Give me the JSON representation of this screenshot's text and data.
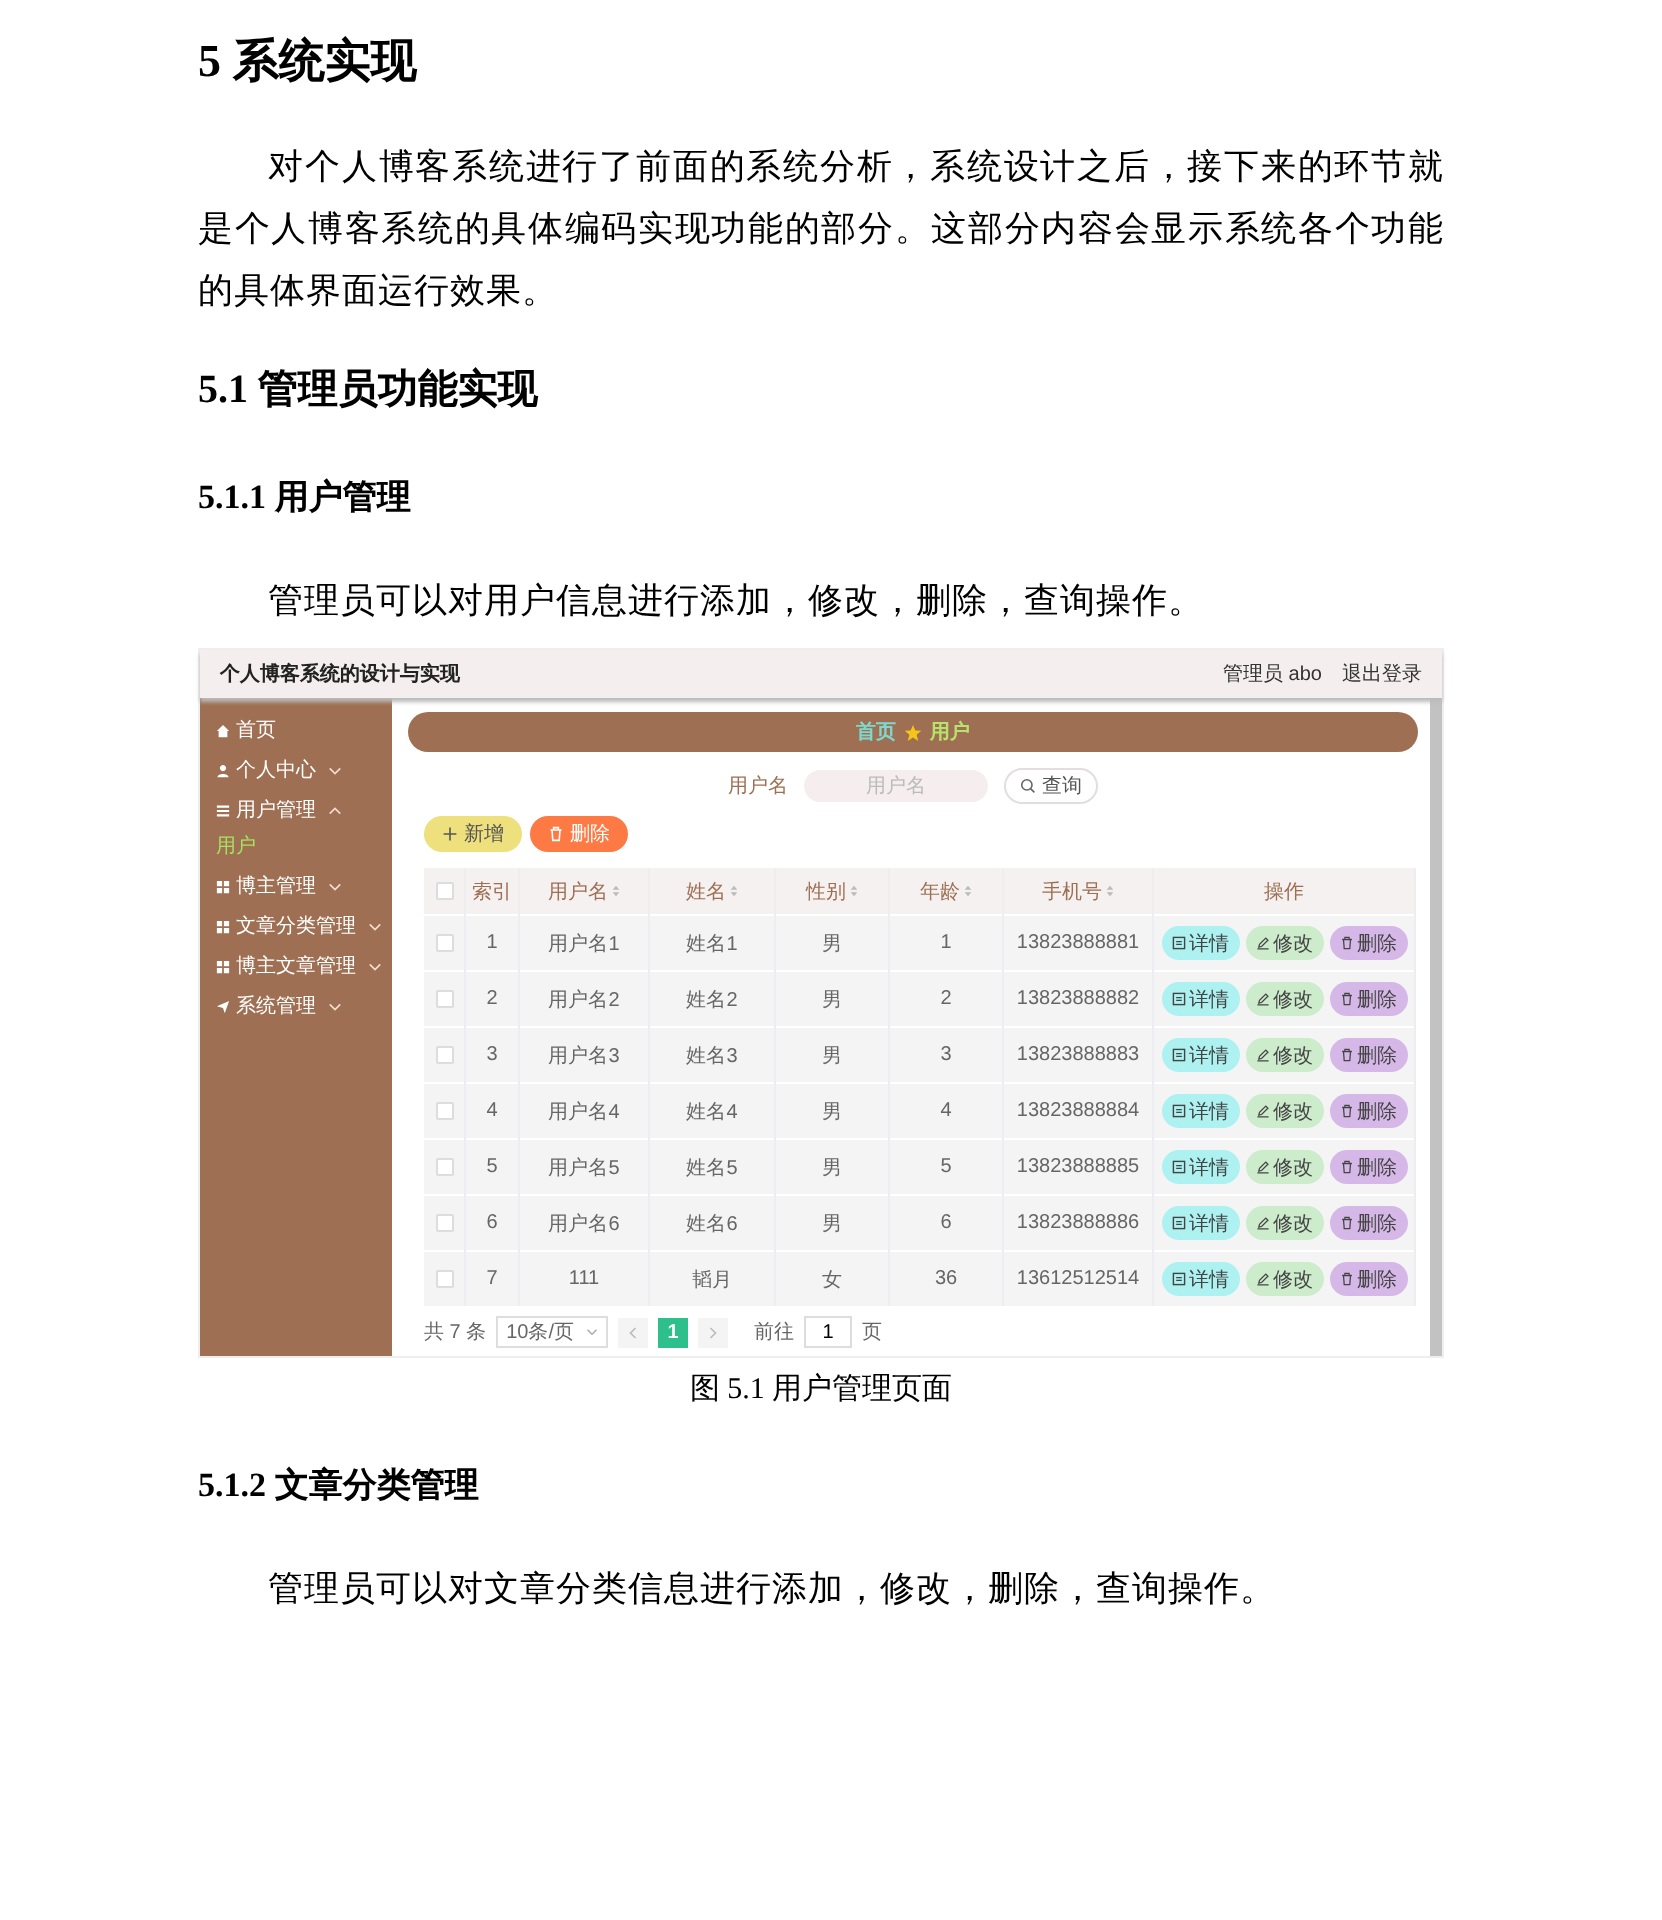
{
  "chapter_heading": "5  系统实现",
  "intro_paragraph": "对个人博客系统进行了前面的系统分析，系统设计之后，接下来的环节就是个人博客系统的具体编码实现功能的部分。这部分内容会显示系统各个功能的具体界面运行效果。",
  "section_heading": "5.1  管理员功能实现",
  "subsection_heading": "5.1.1  用户管理",
  "paragraph": "管理员可以对用户信息进行添加，修改，删除，查询操作。",
  "screenshot": {
    "app_title": "个人博客系统的设计与实现",
    "header_links": [
      "管理员 abo",
      "退出登录"
    ],
    "sidebar": {
      "items": [
        {
          "label": "首页"
        },
        {
          "label": "个人中心",
          "expanded": false
        },
        {
          "label": "用户管理",
          "expanded": true,
          "children": [
            {
              "label": "用户",
              "selected": true
            }
          ]
        },
        {
          "label": "博主管理",
          "expanded": false
        },
        {
          "label": "文章分类管理",
          "expanded": false
        },
        {
          "label": "博主文章管理",
          "expanded": false
        },
        {
          "label": "系统管理",
          "expanded": false
        }
      ]
    },
    "breadcrumb": [
      "首页",
      "用户"
    ],
    "search": {
      "label": "用户名",
      "placeholder": "用户名",
      "button": "查询"
    },
    "toolbar_buttons": [
      {
        "kind": "add",
        "label": "新增"
      },
      {
        "kind": "delete",
        "label": "删除"
      }
    ],
    "table": {
      "select_all_checked": false,
      "columns": [
        {
          "label": "索引",
          "sortable": false
        },
        {
          "label": "用户名",
          "sortable": true
        },
        {
          "label": "姓名",
          "sortable": true
        },
        {
          "label": "性别",
          "sortable": true
        },
        {
          "label": "年龄",
          "sortable": true
        },
        {
          "label": "手机号",
          "sortable": true
        },
        {
          "label": "操作",
          "sortable": false
        }
      ],
      "rows": [
        {
          "checked": false,
          "cells": [
            "1",
            "用户名1",
            "姓名1",
            "男",
            "1",
            "13823888881"
          ],
          "actions": [
            {
              "kind": "detail",
              "label": "详情"
            },
            {
              "kind": "edit",
              "label": "修改"
            },
            {
              "kind": "delete",
              "label": "删除"
            }
          ]
        },
        {
          "checked": false,
          "cells": [
            "2",
            "用户名2",
            "姓名2",
            "男",
            "2",
            "13823888882"
          ],
          "actions": [
            {
              "kind": "detail",
              "label": "详情"
            },
            {
              "kind": "edit",
              "label": "修改"
            },
            {
              "kind": "delete",
              "label": "删除"
            }
          ]
        },
        {
          "checked": false,
          "cells": [
            "3",
            "用户名3",
            "姓名3",
            "男",
            "3",
            "13823888883"
          ],
          "actions": [
            {
              "kind": "detail",
              "label": "详情"
            },
            {
              "kind": "edit",
              "label": "修改"
            },
            {
              "kind": "delete",
              "label": "删除"
            }
          ]
        },
        {
          "checked": false,
          "cells": [
            "4",
            "用户名4",
            "姓名4",
            "男",
            "4",
            "13823888884"
          ],
          "actions": [
            {
              "kind": "detail",
              "label": "详情"
            },
            {
              "kind": "edit",
              "label": "修改"
            },
            {
              "kind": "delete",
              "label": "删除"
            }
          ]
        },
        {
          "checked": false,
          "cells": [
            "5",
            "用户名5",
            "姓名5",
            "男",
            "5",
            "13823888885"
          ],
          "actions": [
            {
              "kind": "detail",
              "label": "详情"
            },
            {
              "kind": "edit",
              "label": "修改"
            },
            {
              "kind": "delete",
              "label": "删除"
            }
          ]
        },
        {
          "checked": false,
          "cells": [
            "6",
            "用户名6",
            "姓名6",
            "男",
            "6",
            "13823888886"
          ],
          "actions": [
            {
              "kind": "detail",
              "label": "详情"
            },
            {
              "kind": "edit",
              "label": "修改"
            },
            {
              "kind": "delete",
              "label": "删除"
            }
          ]
        },
        {
          "checked": false,
          "cells": [
            "7",
            "111",
            "韬月",
            "女",
            "36",
            "13612512514"
          ],
          "actions": [
            {
              "kind": "detail",
              "label": "详情"
            },
            {
              "kind": "edit",
              "label": "修改"
            },
            {
              "kind": "delete",
              "label": "删除"
            }
          ]
        }
      ]
    },
    "pagination": {
      "total": "共 7 条",
      "page_size": "10条/页",
      "pages": [
        {
          "label": "1",
          "selected": true
        }
      ],
      "goto_label": "前往",
      "goto_value": "1",
      "goto_suffix": "页"
    }
  },
  "caption": "图 5.1  用户管理页面",
  "subsection_heading_2": "5.1.2  文章分类管理",
  "paragraph_2": "管理员可以对文章分类信息进行添加，修改，删除，查询操作。"
}
